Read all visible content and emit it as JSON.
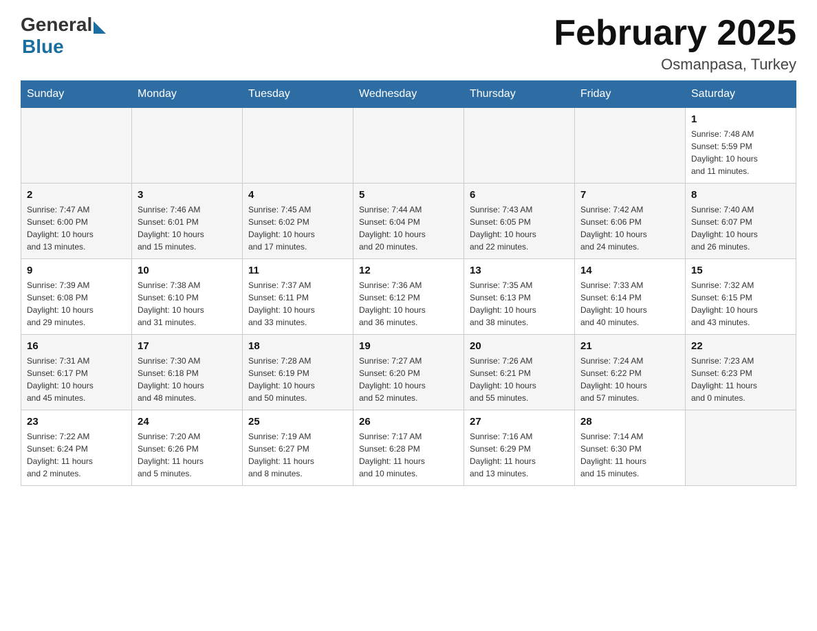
{
  "header": {
    "logo_general": "General",
    "logo_blue": "Blue",
    "month_title": "February 2025",
    "location": "Osmanpasa, Turkey"
  },
  "days_of_week": [
    "Sunday",
    "Monday",
    "Tuesday",
    "Wednesday",
    "Thursday",
    "Friday",
    "Saturday"
  ],
  "weeks": [
    [
      {
        "day": "",
        "info": ""
      },
      {
        "day": "",
        "info": ""
      },
      {
        "day": "",
        "info": ""
      },
      {
        "day": "",
        "info": ""
      },
      {
        "day": "",
        "info": ""
      },
      {
        "day": "",
        "info": ""
      },
      {
        "day": "1",
        "info": "Sunrise: 7:48 AM\nSunset: 5:59 PM\nDaylight: 10 hours\nand 11 minutes."
      }
    ],
    [
      {
        "day": "2",
        "info": "Sunrise: 7:47 AM\nSunset: 6:00 PM\nDaylight: 10 hours\nand 13 minutes."
      },
      {
        "day": "3",
        "info": "Sunrise: 7:46 AM\nSunset: 6:01 PM\nDaylight: 10 hours\nand 15 minutes."
      },
      {
        "day": "4",
        "info": "Sunrise: 7:45 AM\nSunset: 6:02 PM\nDaylight: 10 hours\nand 17 minutes."
      },
      {
        "day": "5",
        "info": "Sunrise: 7:44 AM\nSunset: 6:04 PM\nDaylight: 10 hours\nand 20 minutes."
      },
      {
        "day": "6",
        "info": "Sunrise: 7:43 AM\nSunset: 6:05 PM\nDaylight: 10 hours\nand 22 minutes."
      },
      {
        "day": "7",
        "info": "Sunrise: 7:42 AM\nSunset: 6:06 PM\nDaylight: 10 hours\nand 24 minutes."
      },
      {
        "day": "8",
        "info": "Sunrise: 7:40 AM\nSunset: 6:07 PM\nDaylight: 10 hours\nand 26 minutes."
      }
    ],
    [
      {
        "day": "9",
        "info": "Sunrise: 7:39 AM\nSunset: 6:08 PM\nDaylight: 10 hours\nand 29 minutes."
      },
      {
        "day": "10",
        "info": "Sunrise: 7:38 AM\nSunset: 6:10 PM\nDaylight: 10 hours\nand 31 minutes."
      },
      {
        "day": "11",
        "info": "Sunrise: 7:37 AM\nSunset: 6:11 PM\nDaylight: 10 hours\nand 33 minutes."
      },
      {
        "day": "12",
        "info": "Sunrise: 7:36 AM\nSunset: 6:12 PM\nDaylight: 10 hours\nand 36 minutes."
      },
      {
        "day": "13",
        "info": "Sunrise: 7:35 AM\nSunset: 6:13 PM\nDaylight: 10 hours\nand 38 minutes."
      },
      {
        "day": "14",
        "info": "Sunrise: 7:33 AM\nSunset: 6:14 PM\nDaylight: 10 hours\nand 40 minutes."
      },
      {
        "day": "15",
        "info": "Sunrise: 7:32 AM\nSunset: 6:15 PM\nDaylight: 10 hours\nand 43 minutes."
      }
    ],
    [
      {
        "day": "16",
        "info": "Sunrise: 7:31 AM\nSunset: 6:17 PM\nDaylight: 10 hours\nand 45 minutes."
      },
      {
        "day": "17",
        "info": "Sunrise: 7:30 AM\nSunset: 6:18 PM\nDaylight: 10 hours\nand 48 minutes."
      },
      {
        "day": "18",
        "info": "Sunrise: 7:28 AM\nSunset: 6:19 PM\nDaylight: 10 hours\nand 50 minutes."
      },
      {
        "day": "19",
        "info": "Sunrise: 7:27 AM\nSunset: 6:20 PM\nDaylight: 10 hours\nand 52 minutes."
      },
      {
        "day": "20",
        "info": "Sunrise: 7:26 AM\nSunset: 6:21 PM\nDaylight: 10 hours\nand 55 minutes."
      },
      {
        "day": "21",
        "info": "Sunrise: 7:24 AM\nSunset: 6:22 PM\nDaylight: 10 hours\nand 57 minutes."
      },
      {
        "day": "22",
        "info": "Sunrise: 7:23 AM\nSunset: 6:23 PM\nDaylight: 11 hours\nand 0 minutes."
      }
    ],
    [
      {
        "day": "23",
        "info": "Sunrise: 7:22 AM\nSunset: 6:24 PM\nDaylight: 11 hours\nand 2 minutes."
      },
      {
        "day": "24",
        "info": "Sunrise: 7:20 AM\nSunset: 6:26 PM\nDaylight: 11 hours\nand 5 minutes."
      },
      {
        "day": "25",
        "info": "Sunrise: 7:19 AM\nSunset: 6:27 PM\nDaylight: 11 hours\nand 8 minutes."
      },
      {
        "day": "26",
        "info": "Sunrise: 7:17 AM\nSunset: 6:28 PM\nDaylight: 11 hours\nand 10 minutes."
      },
      {
        "day": "27",
        "info": "Sunrise: 7:16 AM\nSunset: 6:29 PM\nDaylight: 11 hours\nand 13 minutes."
      },
      {
        "day": "28",
        "info": "Sunrise: 7:14 AM\nSunset: 6:30 PM\nDaylight: 11 hours\nand 15 minutes."
      },
      {
        "day": "",
        "info": ""
      }
    ]
  ]
}
